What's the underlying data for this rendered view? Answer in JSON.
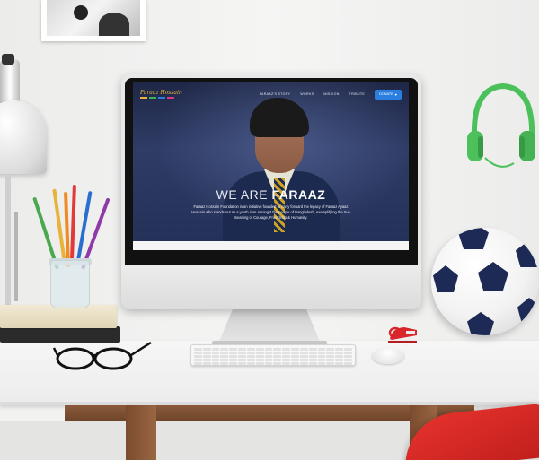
{
  "website": {
    "logo": "Faraaz Hossain",
    "logo_colors": [
      "#e9b23a",
      "#3fb34f",
      "#2a7ee0",
      "#d83a8a"
    ],
    "nav": [
      "FARAAZ'S STORY",
      "WORKS",
      "MISSION",
      "TRIBUTE"
    ],
    "donate_label": "DONATE",
    "donate_icon": "heart-icon",
    "hero_title_light": "WE ARE",
    "hero_title_bold": "FARAAZ",
    "hero_text": "Faraaz Hossain Foundation is an initiative founded to carry forward the legacy of Faraaz Ayaaz Hossain who stands out as a youth icon amongst the people of Bangladesh, exemplifying the true meaning of Courage, Friendship & Humanity."
  },
  "scene": {
    "objects": [
      "desk-lamp",
      "photo-frame",
      "pencil-cup",
      "books",
      "glasses",
      "imac",
      "keyboard",
      "mouse",
      "stapler",
      "headphones",
      "soccer-ball",
      "red-chair"
    ],
    "colors": {
      "headphones": "#4cc05a",
      "ball_patches": "#1c2a55",
      "stapler": "#d9262a",
      "chair": "#d9282a",
      "desk_wood": "#7a4b2e",
      "donate_button": "#2a7ee0"
    }
  }
}
